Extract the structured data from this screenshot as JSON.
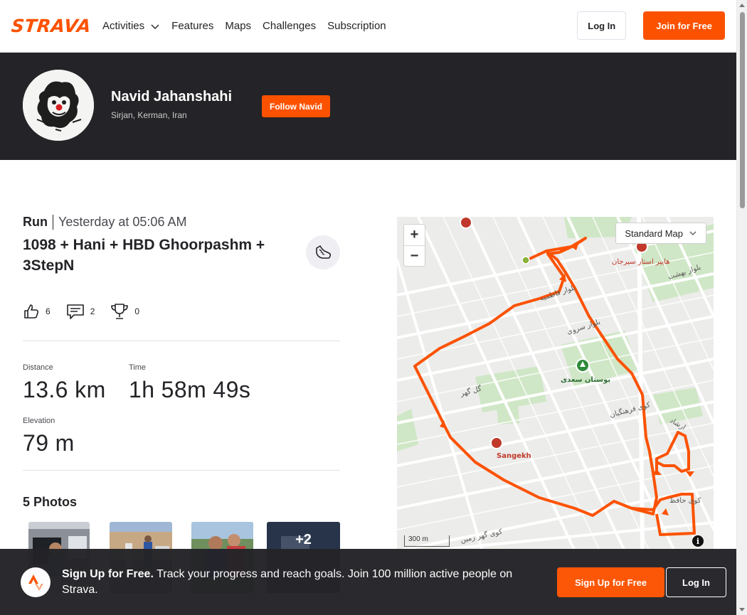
{
  "nav": {
    "logo": "STRAVA",
    "links": [
      {
        "label": "Activities"
      },
      {
        "label": "Features"
      },
      {
        "label": "Maps"
      },
      {
        "label": "Challenges"
      },
      {
        "label": "Subscription"
      }
    ],
    "login_label": "Log In",
    "join_label": "Join for Free"
  },
  "athlete": {
    "name": "Navid Jahanshahi",
    "location": "Sirjan, Kerman, Iran",
    "follow_label": "Follow Navid"
  },
  "activity": {
    "type": "Run",
    "date": "Yesterday at 05:06 AM",
    "title": "1098 + Hani + HBD Ghoorpashm + 3StepN",
    "kudos": "6",
    "comments": "2",
    "achievements": "0",
    "stats": [
      {
        "label": "Distance",
        "value": "13.6 km"
      },
      {
        "label": "Time",
        "value": "1h 58m 49s"
      },
      {
        "label": "Elevation",
        "value": "79 m"
      }
    ],
    "photos_title": "5 Photos",
    "more_photos": "+2"
  },
  "map": {
    "zoom_in": "+",
    "zoom_out": "−",
    "style_label": "Standard Map",
    "scale_label": "300 m",
    "info": "i",
    "route_color": "#fc5200",
    "labels": {
      "sangekh": "Sangekh",
      "park": "بوستان سعدی",
      "hyper": "هایپر استار سیرجان",
      "fatemieh": "بلوار فاطمیه",
      "sarvi": "بلوار سروی",
      "golgohar": "گل گهر",
      "farhangian": "کوی فرهنگیان",
      "behesht": "بلوار بهشت",
      "gohar_zamin": "کوی گهر زمین",
      "hafez": "کوی حافظ",
      "ershad": "ارشاد"
    }
  },
  "cta": {
    "bold": "Sign Up for Free.",
    "text": " Track your progress and reach goals. Join 100 million active people on Strava.",
    "signup_label": "Sign Up for Free",
    "login_label": "Log In"
  },
  "colors": {
    "brand": "#fc5200",
    "dark": "#242428"
  }
}
